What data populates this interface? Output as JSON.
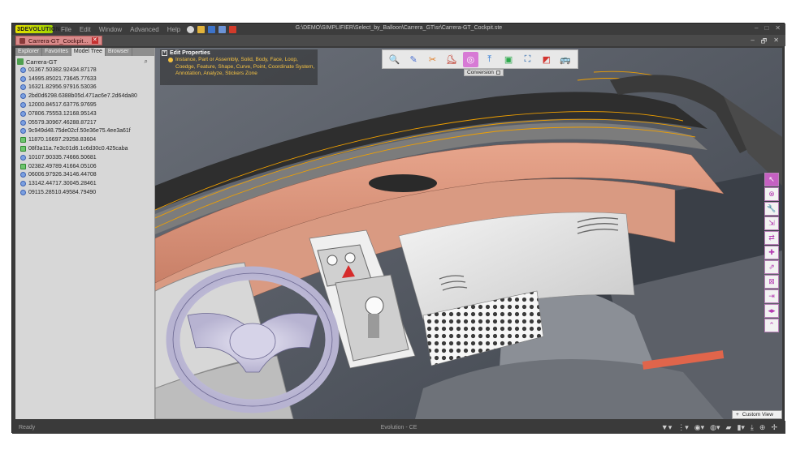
{
  "app": {
    "logo_prefix": "3D",
    "logo_text": "EVOLUTION",
    "menu": [
      "File",
      "Edit",
      "Window",
      "Advanced",
      "Help"
    ],
    "window_title": "G:\\DEMO\\SIMPLIFIER\\Select_by_Balloon\\Carrera_GT\\sr\\Carrera-GT_Cockpit.ste",
    "window_controls": [
      "–",
      "□",
      "✕"
    ]
  },
  "document": {
    "tab_label": "Carrera-GT_Cockpit...",
    "tab_close": "✕",
    "controls": [
      "–",
      "🗗",
      "✕"
    ]
  },
  "panel": {
    "tabs": [
      "Explorer",
      "Favorites",
      "Model Tree",
      "Browser"
    ],
    "active_tab": "Model Tree",
    "root_label": "Carrera-GT",
    "search_icon": "search-icon",
    "items": [
      {
        "label": "01367.50382.92434.87178",
        "kind": "part"
      },
      {
        "label": "14995.85021.73645.77633",
        "kind": "part"
      },
      {
        "label": "16321.82956.97916.53036",
        "kind": "part"
      },
      {
        "label": "2bd0d6298.6388b05d.471ac6e7.2d64da80",
        "kind": "part"
      },
      {
        "label": "12000.84517.63776.97695",
        "kind": "part"
      },
      {
        "label": "07806.75553.12168.95143",
        "kind": "part"
      },
      {
        "label": "05579.30967.46288.87217",
        "kind": "part"
      },
      {
        "label": "9c949d48.75de02cf.50e36e75.4ee3a61f",
        "kind": "part"
      },
      {
        "label": "11870.16697.29258.83604",
        "kind": "assembly"
      },
      {
        "label": "08f3a11a.7e3c01d6.1c6d30c0.425caba",
        "kind": "assembly"
      },
      {
        "label": "10107.90335.74666.50681",
        "kind": "part"
      },
      {
        "label": "02382.49789.41664.05106",
        "kind": "assembly"
      },
      {
        "label": "06006.97926.34146.44708",
        "kind": "part"
      },
      {
        "label": "13142.44717.30045.28461",
        "kind": "part"
      },
      {
        "label": "09115.28510.49584.79490",
        "kind": "part"
      }
    ]
  },
  "edit_properties": {
    "plus": "+",
    "title": "Edit Properties",
    "text": "Instance, Part or Assembly, Solid, Body, Face, Loop, Coedge, Feature, Shape, Curve, Point, Coordinate System, Annotation, Analyze, Stickers Zone"
  },
  "center_toolbar": {
    "buttons": [
      {
        "name": "search-tool",
        "glyph": "🔍",
        "color": "#d4a017"
      },
      {
        "name": "edit-tool",
        "glyph": "✎",
        "color": "#4a6fd1"
      },
      {
        "name": "repair-tool",
        "glyph": "✂",
        "color": "#e07a1f"
      },
      {
        "name": "boot-tool",
        "glyph": "⛸",
        "color": "#c0392b"
      },
      {
        "name": "simplify-tool",
        "glyph": "◎",
        "color": "#ffffff"
      },
      {
        "name": "export-tool",
        "glyph": "⤒",
        "color": "#1e6fd1"
      },
      {
        "name": "bound-tool",
        "glyph": "▣",
        "color": "#2aa84a"
      },
      {
        "name": "fit-tool",
        "glyph": "⛶",
        "color": "#1e5fa8"
      },
      {
        "name": "section-tool",
        "glyph": "◩",
        "color": "#d2342f"
      },
      {
        "name": "vehicle-tool",
        "glyph": "🚌",
        "color": "#2e7d32"
      }
    ],
    "selected_index": 4,
    "caption": "Conversion"
  },
  "right_toolbar": {
    "buttons": [
      "↖",
      "⊗",
      "🔧",
      "⇲",
      "⇄",
      "✚",
      "⇗",
      "⊠",
      "⇥",
      "◂▸",
      "⌃"
    ]
  },
  "custom_view": {
    "plus": "+",
    "label": "Custom View"
  },
  "status": {
    "left": "Ready",
    "center": "Evolution - CE",
    "icons": [
      "▼▾",
      "⋮▾",
      "◉▾",
      "◍▾",
      "▰",
      "▮▾",
      "⤓",
      "⊕",
      "✢"
    ]
  },
  "colors": {
    "accent": "#c560c2",
    "dashboard": "#d9957d",
    "selection": "#f0a000"
  }
}
